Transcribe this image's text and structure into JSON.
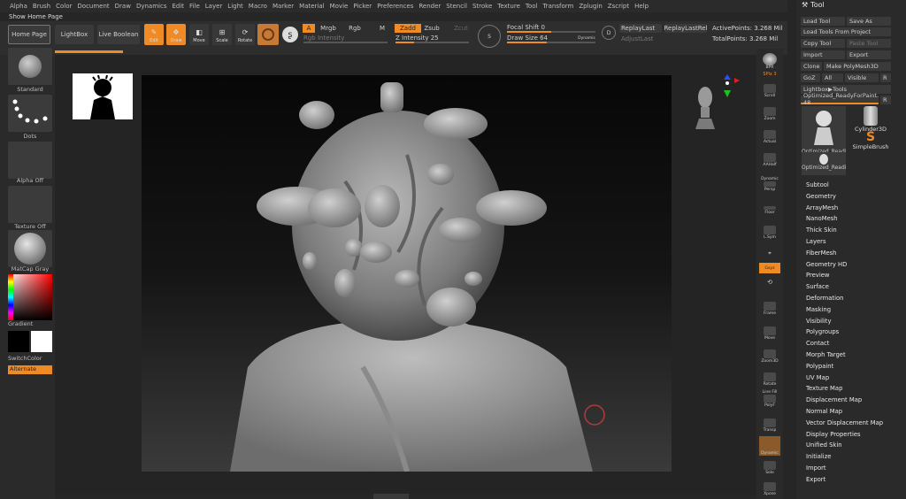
{
  "menu": [
    "Alpha",
    "Brush",
    "Color",
    "Document",
    "Draw",
    "Dynamics",
    "Edit",
    "File",
    "Layer",
    "Light",
    "Macro",
    "Marker",
    "Material",
    "Movie",
    "Picker",
    "Preferences",
    "Render",
    "Stencil",
    "Stroke",
    "Texture",
    "Tool",
    "Transform",
    "Zplugin",
    "Zscript",
    "Help"
  ],
  "show_home_page": "Show Home Page",
  "shelf": {
    "home_page": "Home Page",
    "lightbox": "LightBox",
    "live_boolean": "Live Boolean",
    "edit": "Edit",
    "draw": "Draw",
    "move": "Move",
    "scale": "Scale",
    "rotate": "Rotate",
    "a": "A",
    "mrgb": "Mrgb",
    "rgb": "Rgb",
    "m": "M",
    "zadd": "Zadd",
    "zsub": "Zsub",
    "zcut": "Zcut",
    "rgb_intensity": "Rgb Intensity",
    "z_intensity": "Z Intensity 25",
    "focal_shift": "Focal Shift 0",
    "draw_size": "Draw Size 64",
    "dynamic": "Dynamic",
    "replay_last": "ReplayLast",
    "replay_last_rel": "ReplayLastRel",
    "adjust_last": "AdjustLast",
    "active_points": "ActivePoints: 3.268 Mil",
    "total_points": "TotalPoints: 3.268 Mil",
    "z_intensity_level": 0.25,
    "focal_level": 0.5,
    "draw_size_level": 0.45
  },
  "left": {
    "standard": "Standard",
    "dots": "Dots",
    "alpha_off": "Alpha Off",
    "texture_off": "Texture Off",
    "matcap": "MatCap Gray",
    "gradient": "Gradient",
    "switch_color": "SwitchColor",
    "alternate": "Alternate"
  },
  "right_strip": {
    "bpr": "BPR",
    "spix": "SPix 3",
    "scroll": "Scroll",
    "zoom": "Zoom",
    "actual": "Actual",
    "aahalf": "AAHalf",
    "dynamic": "Dynamic",
    "persp": "Persp",
    "floor": "Floor",
    "lsym": "L.Sym",
    "gxyz": "Gxyz",
    "frame": "Frame",
    "move": "Move",
    "zoom3d": "Zoom3D",
    "rotate": "Rotate",
    "linefill": "Line Fill",
    "polyf": "PolyF",
    "transp": "Transp",
    "solo": "Solo",
    "dynamic2": "Dynamic",
    "xpose": "Xpose"
  },
  "tool": {
    "title": "Tool",
    "load_tool": "Load Tool",
    "save_as": "Save As",
    "load_from_project": "Load Tools From Project",
    "copy_tool": "Copy Tool",
    "paste_tool": "Paste Tool",
    "import": "Import",
    "export": "Export",
    "clone": "Clone",
    "make_polymesh": "Make PolyMesh3D",
    "goz": "GoZ",
    "all": "All",
    "visible": "Visible",
    "r": "R",
    "lightbox_tools": "Lightbox▶Tools",
    "current_tool": "Optimized_ReadyForPaint. 48",
    "thumb1": "Optimized_Readi",
    "thumb2": "Cylinder3D",
    "thumb3": "SimpleBrush",
    "thumb4": "Optimized_Readi",
    "sections": [
      "Subtool",
      "Geometry",
      "ArrayMesh",
      "NanoMesh",
      "Thick Skin",
      "Layers",
      "FiberMesh",
      "Geometry HD",
      "Preview",
      "Surface",
      "Deformation",
      "Masking",
      "Visibility",
      "Polygroups",
      "Contact",
      "Morph Target",
      "Polypaint",
      "UV Map",
      "Texture Map",
      "Displacement Map",
      "Normal Map",
      "Vector Displacement Map",
      "Display Properties",
      "Unified Skin",
      "Initialize",
      "Import",
      "Export"
    ]
  }
}
